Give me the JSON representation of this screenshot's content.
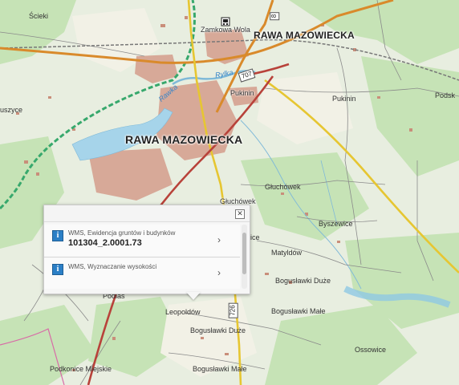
{
  "map": {
    "place_labels": {
      "scieki": "Ścieki",
      "zamkowa_wola": "Zamkowa Wola",
      "rawa_ne": "RAWA MAZOWIECKA",
      "rawa_center": "RAWA MAZOWIECKA",
      "pukinin_1": "Pukinin",
      "pukinin_2": "Pukinin",
      "podska": "Podsk",
      "uszyce": "uszyce",
      "gluchowek_1": "Głuchówek",
      "gluchowek_2": "Głuchówek",
      "byszewice": "Byszewice",
      "matyldow": "Matyldów",
      "boguslawki_duze_1": "Bogusławki Duże",
      "boguslawki_male_1": "Bogusławki Małe",
      "leopoldow": "Leopoldów",
      "boguslawki_duze_2": "Bogusławki Duże",
      "boguslawki_male_2": "Bogusławki Małe",
      "ossowice": "Ossowice",
      "podkonice": "Podkonice Miejskie",
      "podlas": "Podlas",
      "partial_ice": "ice"
    },
    "river_labels": {
      "rawka": "Rawka",
      "rylka": "Rylka"
    },
    "road_numbers": {
      "r8": "8",
      "r707": "707",
      "r726": "726"
    },
    "colors": {
      "road_main": "#d98a2b",
      "road_yellow": "#e6c632",
      "road_red": "#b8423a",
      "water": "#9fd1ea",
      "forest": "#bfe0b0",
      "urban": "#d3a595",
      "boundary": "#3aa86a"
    }
  },
  "popup": {
    "close_glyph": "✕",
    "rows": [
      {
        "title": "WMS, Ewidencja gruntów i budynków",
        "value": "101304_2.0001.73",
        "chevron": "›"
      },
      {
        "title": "WMS, Wyznaczanie wysokości",
        "value": "",
        "chevron": "›"
      }
    ]
  }
}
